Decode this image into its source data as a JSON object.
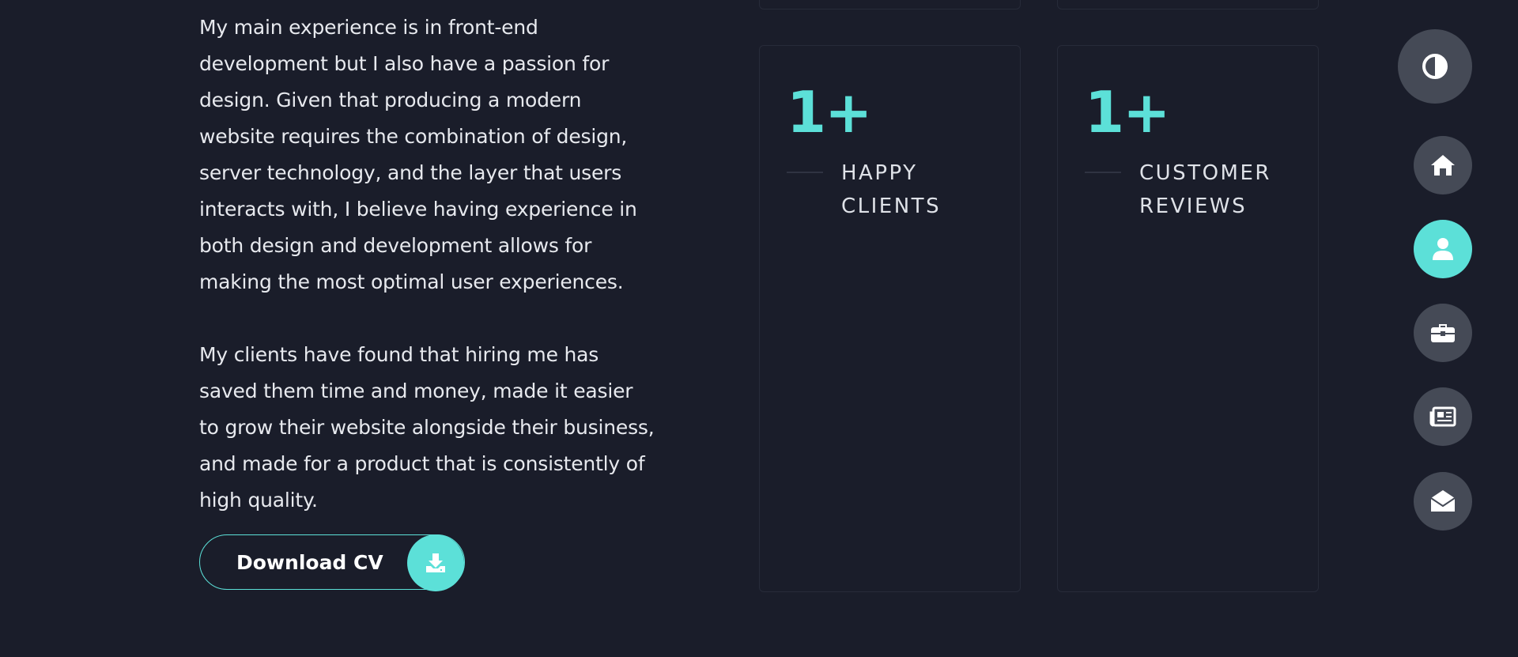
{
  "about": {
    "paragraph_1": "My main experience is in front-end development but I also have a passion for design. Given that producing a modern website requires the combination of design, server technology, and the layer that users interacts with, I believe having experience in both design and development allows for making the most optimal user experiences.",
    "paragraph_2": "My clients have found that hiring me has saved them time and money, made it easier to grow their website alongside their business, and made for a product that is consistently of high quality."
  },
  "download_button": {
    "label": "Download CV",
    "icon": "download-icon"
  },
  "stats": [
    {
      "number": "1+",
      "label_line1": "HAPPY",
      "label_line2": "CLIENTS"
    },
    {
      "number": "1+",
      "label_line1": "CUSTOMER",
      "label_line2": "REVIEWS"
    }
  ],
  "side_nav": {
    "theme_toggle_icon": "contrast-icon",
    "items": [
      {
        "icon": "home-icon",
        "active": false
      },
      {
        "icon": "user-icon",
        "active": true
      },
      {
        "icon": "briefcase-icon",
        "active": false
      },
      {
        "icon": "newspaper-icon",
        "active": false
      },
      {
        "icon": "envelope-open-icon",
        "active": false
      }
    ]
  },
  "colors": {
    "background": "#1a1d2a",
    "accent": "#5ce0d8",
    "nav_button": "#454a56",
    "card_border": "#272b39",
    "text": "#e7e9ee"
  }
}
